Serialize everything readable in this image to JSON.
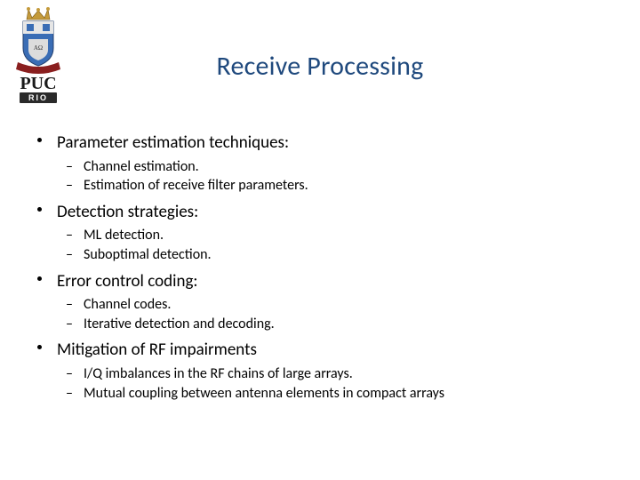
{
  "title": "Receive Processing",
  "logo": {
    "top_text": "PUC",
    "sub_text": "RIO",
    "shield_color": "#3a6db5",
    "crown_color": "#c49a3a",
    "ribbon_color": "#8a1f1f"
  },
  "bullets": [
    {
      "label": "Parameter estimation techniques:",
      "sub": [
        "Channel estimation.",
        "Estimation of receive filter parameters."
      ]
    },
    {
      "label": "Detection strategies:",
      "sub": [
        "ML detection.",
        "Suboptimal detection."
      ]
    },
    {
      "label": "Error control coding:",
      "sub": [
        "Channel codes.",
        "Iterative detection and decoding."
      ]
    },
    {
      "label": "Mitigation of RF impairments",
      "sub": [
        "I/Q imbalances in the RF chains of large arrays.",
        "Mutual coupling between antenna elements in compact arrays"
      ]
    }
  ]
}
